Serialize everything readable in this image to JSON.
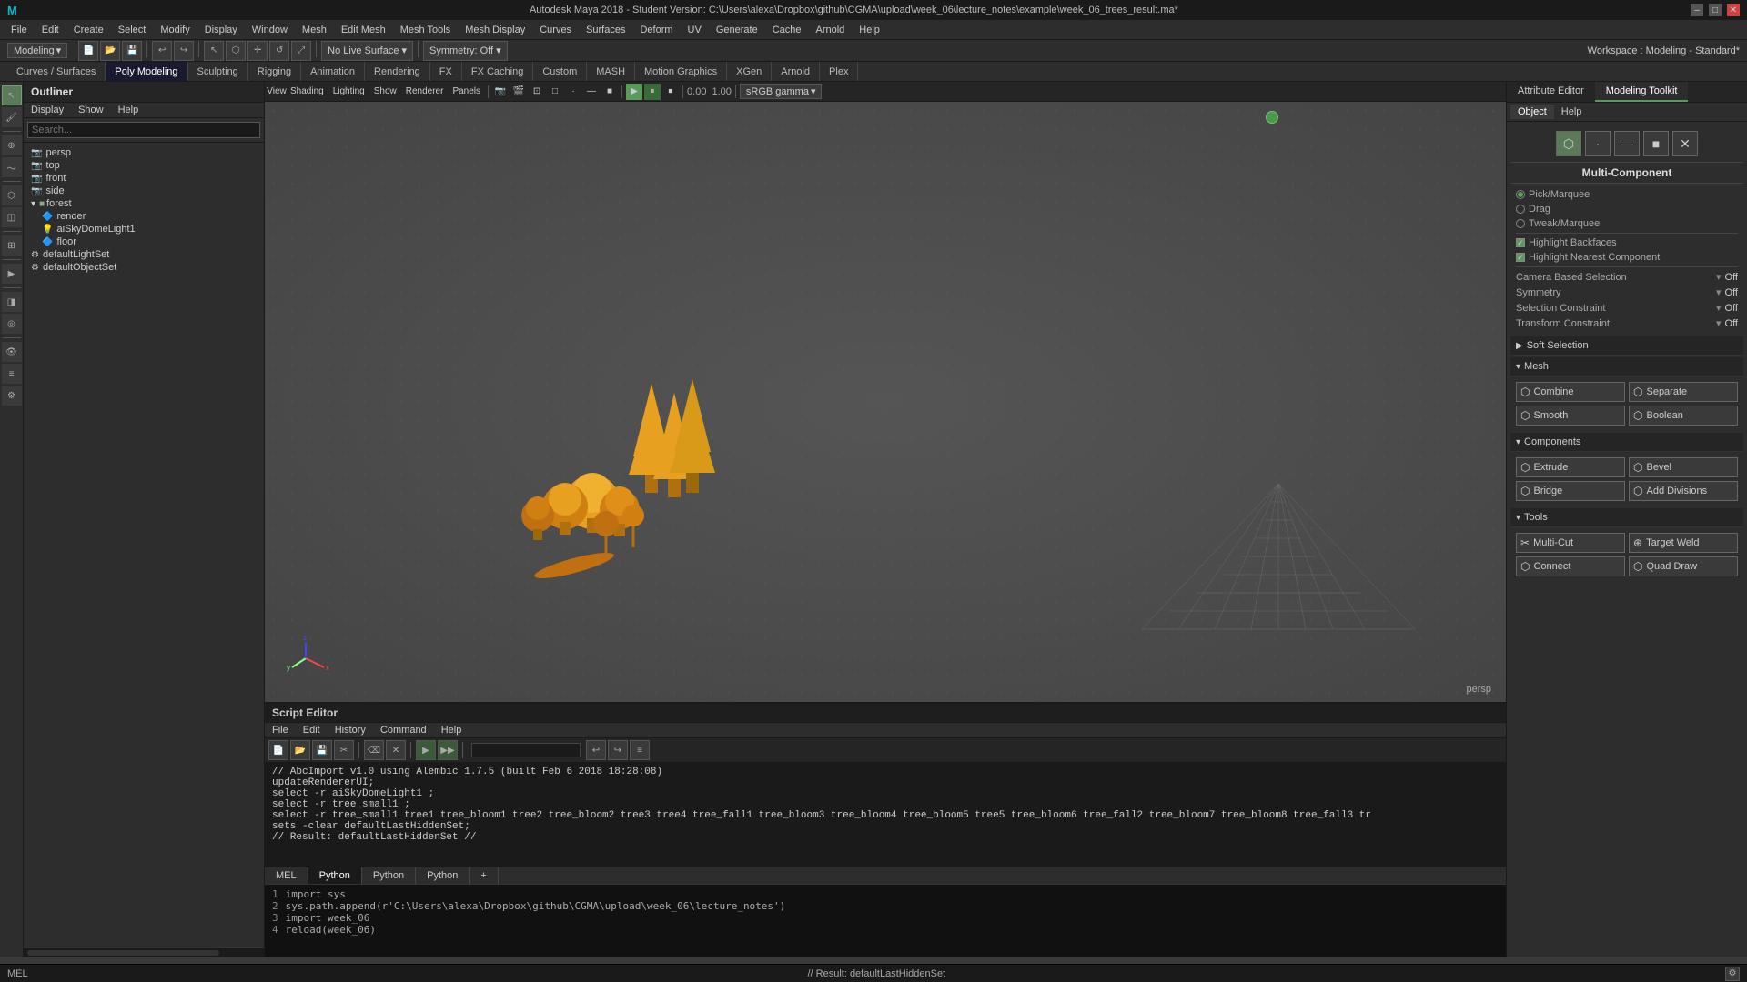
{
  "titlebar": {
    "title": "Autodesk Maya 2018 - Student Version: C:\\Users\\alexa\\Dropbox\\github\\CGMA\\upload\\week_06\\lecture_notes\\example\\week_06_trees_result.ma*",
    "minimize": "–",
    "maximize": "□",
    "close": "✕"
  },
  "menubar": {
    "items": [
      "File",
      "Edit",
      "Create",
      "Select",
      "Modify",
      "Display",
      "Window",
      "Mesh",
      "Edit Mesh",
      "Mesh Tools",
      "Mesh Display",
      "Curves",
      "Surfaces",
      "Deform",
      "UV",
      "Generate",
      "Cache",
      "Arnold",
      "Help"
    ]
  },
  "workspace": {
    "mode": "Modeling",
    "label": "Workspace : Modeling - Standard*"
  },
  "cattabs": {
    "items": [
      "Curves / Surfaces",
      "Poly Modeling",
      "Sculpting",
      "Rigging",
      "Animation",
      "Rendering",
      "FX",
      "FX Caching",
      "Custom",
      "MASH",
      "Motion Graphics",
      "XGen",
      "Arnold",
      "Plex"
    ]
  },
  "outliner": {
    "header": "Outliner",
    "menu": [
      "Display",
      "Show",
      "Help"
    ],
    "search_placeholder": "Search...",
    "tree": [
      {
        "label": "persp",
        "icon": "📷",
        "indent": 0
      },
      {
        "label": "top",
        "icon": "📷",
        "indent": 0
      },
      {
        "label": "front",
        "icon": "📷",
        "indent": 0
      },
      {
        "label": "side",
        "icon": "📷",
        "indent": 0
      },
      {
        "label": "forest",
        "icon": "📁",
        "indent": 0
      },
      {
        "label": "render",
        "icon": "📦",
        "indent": 1
      },
      {
        "label": "aiSkyDomeLight1",
        "icon": "💡",
        "indent": 1
      },
      {
        "label": "floor",
        "icon": "📦",
        "indent": 1
      },
      {
        "label": "defaultLightSet",
        "icon": "🔧",
        "indent": 0
      },
      {
        "label": "defaultObjectSet",
        "icon": "🔧",
        "indent": 0
      }
    ]
  },
  "viewport": {
    "menus": [
      "View",
      "Shading",
      "Lighting",
      "Show",
      "Renderer",
      "Panels"
    ],
    "label": "persp",
    "gamma_label": "sRGB gamma",
    "zoom_value": "0.00",
    "zoom_factor": "1.00"
  },
  "right_panel": {
    "tabs": [
      "Attribute Editor",
      "Modeling Toolkit"
    ],
    "active_tab": "Modeling Toolkit",
    "sub_tabs": [
      "Object",
      "Help"
    ],
    "mode_label": "Multi-Component",
    "sections": {
      "pick_marquee": {
        "label": "Pick/Marquee",
        "radio": true
      },
      "drag": {
        "label": "Drag",
        "radio": false
      },
      "tweak_marquee": {
        "label": "Tweak/Marquee",
        "radio": false
      },
      "highlight_backfaces": {
        "label": "Highlight Backfaces",
        "checked": true
      },
      "highlight_nearest": {
        "label": "Highlight Nearest Component",
        "checked": true
      },
      "camera_based_selection": {
        "label": "Camera Based Selection",
        "toggle": "Off"
      },
      "symmetry": {
        "label": "Symmetry",
        "toggle": "Off"
      },
      "selection_constraint": {
        "label": "Selection Constraint",
        "toggle": "Off"
      },
      "transform_constraint": {
        "label": "Transform Constraint",
        "toggle": "Off"
      }
    },
    "soft_selection_label": "Soft Selection",
    "mesh_label": "Mesh",
    "mesh_buttons": [
      {
        "label": "Combine",
        "icon": "⬡"
      },
      {
        "label": "Separate",
        "icon": "⬡"
      },
      {
        "label": "Smooth",
        "icon": "⬡"
      },
      {
        "label": "Boolean",
        "icon": "⬡"
      }
    ],
    "components_label": "Components",
    "component_buttons": [
      {
        "label": "Extrude",
        "icon": "⬡"
      },
      {
        "label": "Bevel",
        "icon": "⬡"
      },
      {
        "label": "Bridge",
        "icon": "⬡"
      },
      {
        "label": "Add Divisions",
        "icon": "⬡"
      }
    ],
    "tools_label": "Tools",
    "tool_buttons": [
      {
        "label": "Multi-Cut",
        "icon": "✂"
      },
      {
        "label": "Target Weld",
        "icon": "⊕"
      },
      {
        "label": "Connect",
        "icon": "⬡"
      },
      {
        "label": "Quad Draw",
        "icon": "⬡"
      }
    ]
  },
  "script_editor": {
    "header": "Script Editor",
    "menus": [
      "File",
      "Edit",
      "History",
      "Command",
      "Help"
    ],
    "output": [
      "// AbcImport v1.0 using Alembic 1.7.5 (built Feb  6 2018 18:28:08)",
      "updateRendererUI;",
      "select -r aiSkyDomeLight1 ;",
      "select -r tree_small1 ;",
      "select -r tree_small1 tree1 tree_bloom1 tree2 tree_bloom2 tree3 tree4 tree_fall1 tree_bloom3 tree_bloom4 tree_bloom5 tree5 tree_bloom6 tree_fall2 tree_bloom7 tree_bloom8 tree_fall3 tr",
      "sets -clear defaultLastHiddenSet;",
      "// Result: defaultLastHiddenSet //"
    ],
    "tabs": [
      "MEL",
      "Python",
      "Python",
      "Python",
      "+"
    ],
    "active_tab": "Python",
    "input_lines": [
      "import sys",
      "sys.path.append(r'C:\\Users\\alexa\\Dropbox\\github\\CGMA\\upload\\week_06\\lecture_notes')",
      "import week_06",
      "reload(week_06)"
    ]
  },
  "statusbar": {
    "left": "MEL",
    "right": "// Result: defaultLastHiddenSet"
  }
}
